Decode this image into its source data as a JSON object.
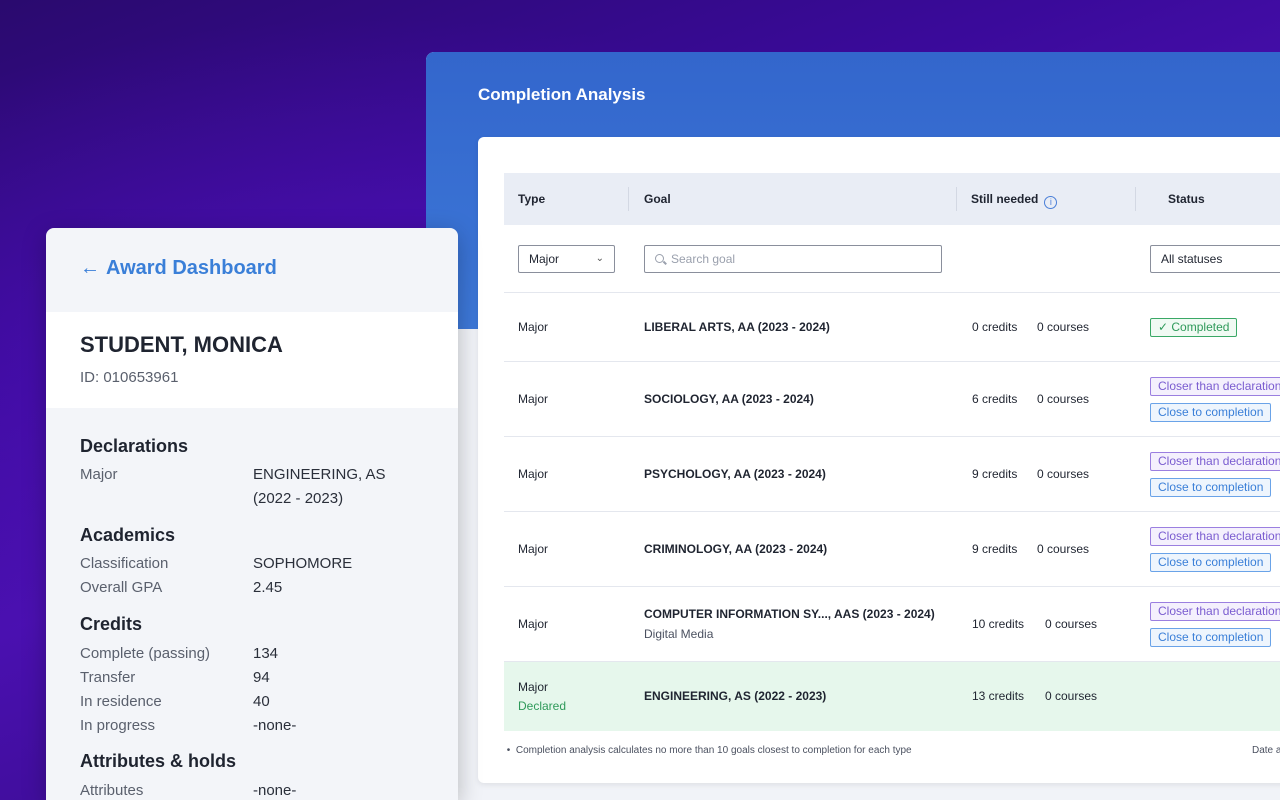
{
  "completion_analysis": {
    "title": "Completion Analysis",
    "columns": {
      "type": "Type",
      "goal": "Goal",
      "still_needed": "Still needed",
      "info_icon": "i",
      "status": "Status"
    },
    "filters": {
      "type_value": "Major",
      "search_placeholder": "Search goal",
      "status_value": "All statuses"
    },
    "rows": [
      {
        "type": "Major",
        "goal": "LIBERAL ARTS, AA  (2023 - 2024)",
        "credits": "0 credits",
        "courses": "0 courses",
        "badges": [
          "✓  Completed"
        ]
      },
      {
        "type": "Major",
        "goal": "SOCIOLOGY, AA  (2023 - 2024)",
        "credits": "6 credits",
        "courses": "0 courses",
        "badges": [
          "Closer than declaration",
          "Close to completion"
        ]
      },
      {
        "type": "Major",
        "goal": "PSYCHOLOGY, AA  (2023 - 2024)",
        "credits": "9 credits",
        "courses": "0 courses",
        "badges": [
          "Closer than declaration",
          "Close to completion"
        ]
      },
      {
        "type": "Major",
        "goal": "CRIMINOLOGY, AA  (2023 - 2024)",
        "credits": "9 credits",
        "courses": "0 courses",
        "badges": [
          "Closer than declaration",
          "Close to completion"
        ]
      },
      {
        "type": "Major",
        "goal": "COMPUTER INFORMATION SY..., AAS  (2023 - 2024)",
        "sub": "Digital Media",
        "credits": "10 credits",
        "courses": "0 courses",
        "badges": [
          "Closer than declaration",
          "Close to completion"
        ]
      },
      {
        "type": "Major",
        "sub": "Declared",
        "goal": "ENGINEERING, AS  (2022 - 2023)",
        "credits": "13 credits",
        "courses": "0 courses",
        "badges": []
      }
    ],
    "footnote": "Completion analysis calculates no more than 10 goals closest to completion for each type",
    "footnote_right": "Date a",
    "colors": {
      "header_blue": "#3366cc",
      "completed_green": "#2f9a5a",
      "closer_purple": "#7a5cd0",
      "close_blue": "#3a7fd8",
      "declared_bg": "#e6f7ec"
    }
  },
  "award_dashboard": {
    "back_label": "Award Dashboard",
    "back_icon": "arrow-left-icon",
    "student_name": "STUDENT, MONICA",
    "student_id": "ID: 010653961",
    "declarations": {
      "title": "Declarations",
      "major_label": "Major",
      "major_value_line1": "ENGINEERING, AS",
      "major_value_line2": "(2022 - 2023)"
    },
    "academics": {
      "title": "Academics",
      "classification_label": "Classification",
      "classification_value": "SOPHOMORE",
      "gpa_label": "Overall GPA",
      "gpa_value": "2.45"
    },
    "credits": {
      "title": "Credits",
      "complete_label": "Complete (passing)",
      "complete_value": "134",
      "transfer_label": "Transfer",
      "transfer_value": "94",
      "residence_label": "In residence",
      "residence_value": "40",
      "progress_label": "In progress",
      "progress_value": "-none-"
    },
    "attributes": {
      "title": "Attributes & holds",
      "attributes_label": "Attributes",
      "attributes_value": "-none-"
    }
  }
}
